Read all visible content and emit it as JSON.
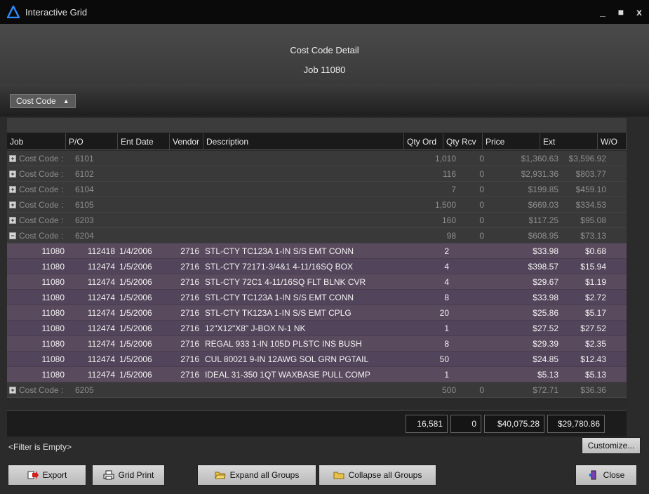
{
  "window": {
    "title": "Interactive Grid",
    "minimize": "_",
    "maximize": "■",
    "close": "x"
  },
  "report": {
    "title": "Cost Code Detail",
    "subtitle": "Job 11080"
  },
  "groupbar": {
    "chip_label": "Cost Code",
    "sort_arrow": "▲"
  },
  "columns": [
    "Job",
    "P/O",
    "Ent Date",
    "Vendor",
    "Description",
    "Qty Ord",
    "Qty Rcv",
    "Price",
    "Ext",
    "W/O"
  ],
  "groups_before": [
    {
      "label": "Cost Code :",
      "code": "6101",
      "qty_ord": "1,010",
      "qty_rcv": "0",
      "price": "$1,360.63",
      "ext": "$3,596.92",
      "expander": "+"
    },
    {
      "label": "Cost Code :",
      "code": "6102",
      "qty_ord": "116",
      "qty_rcv": "0",
      "price": "$2,931.36",
      "ext": "$803.77",
      "expander": "+"
    },
    {
      "label": "Cost Code :",
      "code": "6104",
      "qty_ord": "7",
      "qty_rcv": "0",
      "price": "$199.85",
      "ext": "$459.10",
      "expander": "+"
    },
    {
      "label": "Cost Code :",
      "code": "6105",
      "qty_ord": "1,500",
      "qty_rcv": "0",
      "price": "$669.03",
      "ext": "$334.53",
      "expander": "+"
    },
    {
      "label": "Cost Code :",
      "code": "6203",
      "qty_ord": "160",
      "qty_rcv": "0",
      "price": "$117.25",
      "ext": "$95.08",
      "expander": "+"
    },
    {
      "label": "Cost Code :",
      "code": "6204",
      "qty_ord": "98",
      "qty_rcv": "0",
      "price": "$608.95",
      "ext": "$73.13",
      "expander": "−"
    }
  ],
  "detail_rows": [
    {
      "job": "11080",
      "po": "112418",
      "date": "1/4/2006",
      "vendor": "2716",
      "desc": "STL-CTY TC123A 1-IN S/S EMT CONN",
      "qty": "2",
      "price": "$33.98",
      "ext": "$0.68"
    },
    {
      "job": "11080",
      "po": "112474",
      "date": "1/5/2006",
      "vendor": "2716",
      "desc": "STL-CTY 72171-3/4&1 4-11/16SQ BOX",
      "qty": "4",
      "price": "$398.57",
      "ext": "$15.94"
    },
    {
      "job": "11080",
      "po": "112474",
      "date": "1/5/2006",
      "vendor": "2716",
      "desc": "STL-CTY 72C1 4-11/16SQ FLT BLNK CVR",
      "qty": "4",
      "price": "$29.67",
      "ext": "$1.19"
    },
    {
      "job": "11080",
      "po": "112474",
      "date": "1/5/2006",
      "vendor": "2716",
      "desc": "STL-CTY TC123A 1-IN S/S EMT CONN",
      "qty": "8",
      "price": "$33.98",
      "ext": "$2.72"
    },
    {
      "job": "11080",
      "po": "112474",
      "date": "1/5/2006",
      "vendor": "2716",
      "desc": "STL-CTY TK123A 1-IN S/S EMT CPLG",
      "qty": "20",
      "price": "$25.86",
      "ext": "$5.17"
    },
    {
      "job": "11080",
      "po": "112474",
      "date": "1/5/2006",
      "vendor": "2716",
      "desc": "12\"X12\"X8\" J-BOX N-1 NK",
      "qty": "1",
      "price": "$27.52",
      "ext": "$27.52"
    },
    {
      "job": "11080",
      "po": "112474",
      "date": "1/5/2006",
      "vendor": "2716",
      "desc": "REGAL 933 1-IN 105D PLSTC INS BUSH",
      "qty": "8",
      "price": "$29.39",
      "ext": "$2.35"
    },
    {
      "job": "11080",
      "po": "112474",
      "date": "1/5/2006",
      "vendor": "2716",
      "desc": "CUL 80021 9-IN 12AWG SOL GRN PGTAIL",
      "qty": "50",
      "price": "$24.85",
      "ext": "$12.43"
    },
    {
      "job": "11080",
      "po": "112474",
      "date": "1/5/2006",
      "vendor": "2716",
      "desc": "IDEAL 31-350 1QT WAXBASE PULL COMP",
      "qty": "1",
      "price": "$5.13",
      "ext": "$5.13"
    }
  ],
  "groups_after": [
    {
      "label": "Cost Code :",
      "code": "6205",
      "qty_ord": "500",
      "qty_rcv": "0",
      "price": "$72.71",
      "ext": "$36.36",
      "expander": "+"
    }
  ],
  "totals": {
    "qty_ord": "16,581",
    "qty_rcv": "0",
    "price": "$40,075.28",
    "ext": "$29,780.86"
  },
  "filter_text": "<Filter is Empty>",
  "buttons": {
    "customize": "Customize...",
    "export": "Export",
    "grid_print": "Grid Print",
    "expand": "Expand all Groups",
    "collapse": "Collapse all Groups",
    "close": "Close"
  },
  "colors": {
    "detail_row": "#5a4a5e",
    "group_row": "#393939",
    "accent": "#1f6fe0"
  }
}
